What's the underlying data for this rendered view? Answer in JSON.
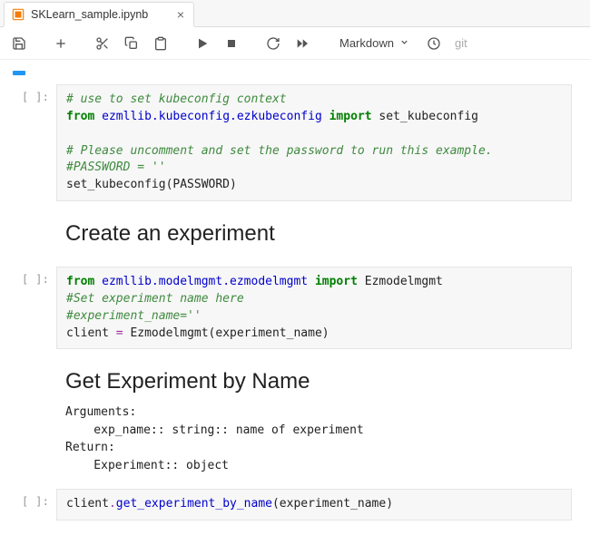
{
  "tab": {
    "title": "SKLearn_sample.ipynb"
  },
  "toolbar": {
    "cell_type": "Markdown",
    "git_label": "git"
  },
  "cells": {
    "c1": {
      "prompt": "[ ]:",
      "line1": "# use to set kubeconfig context",
      "line2a": "from",
      "line2b": "ezmllib.kubeconfig.ezkubeconfig",
      "line2c": "import",
      "line2d": "set_kubeconfig",
      "line3": "",
      "line4": "# Please uncomment and set the password to run this example.",
      "line5": "#PASSWORD = ''",
      "line6": "set_kubeconfig(PASSWORD)"
    },
    "md1": {
      "heading": "Create an experiment"
    },
    "c2": {
      "prompt": "[ ]:",
      "line1a": "from",
      "line1b": "ezmllib.modelmgmt.ezmodelmgmt",
      "line1c": "import",
      "line1d": "Ezmodelmgmt",
      "line2": "#Set experiment name here",
      "line3": "#experiment_name=''",
      "line4a": "client ",
      "line4b": "=",
      "line4c": " Ezmodelmgmt(experiment_name)"
    },
    "md2": {
      "heading": "Get Experiment by Name",
      "body": "Arguments:\n    exp_name:: string:: name of experiment\nReturn:\n    Experiment:: object"
    },
    "c3": {
      "prompt": "[ ]:",
      "line1a": "client",
      "line1b": ".",
      "line1c": "get_experiment_by_name",
      "line1d": "(experiment_name)"
    }
  }
}
